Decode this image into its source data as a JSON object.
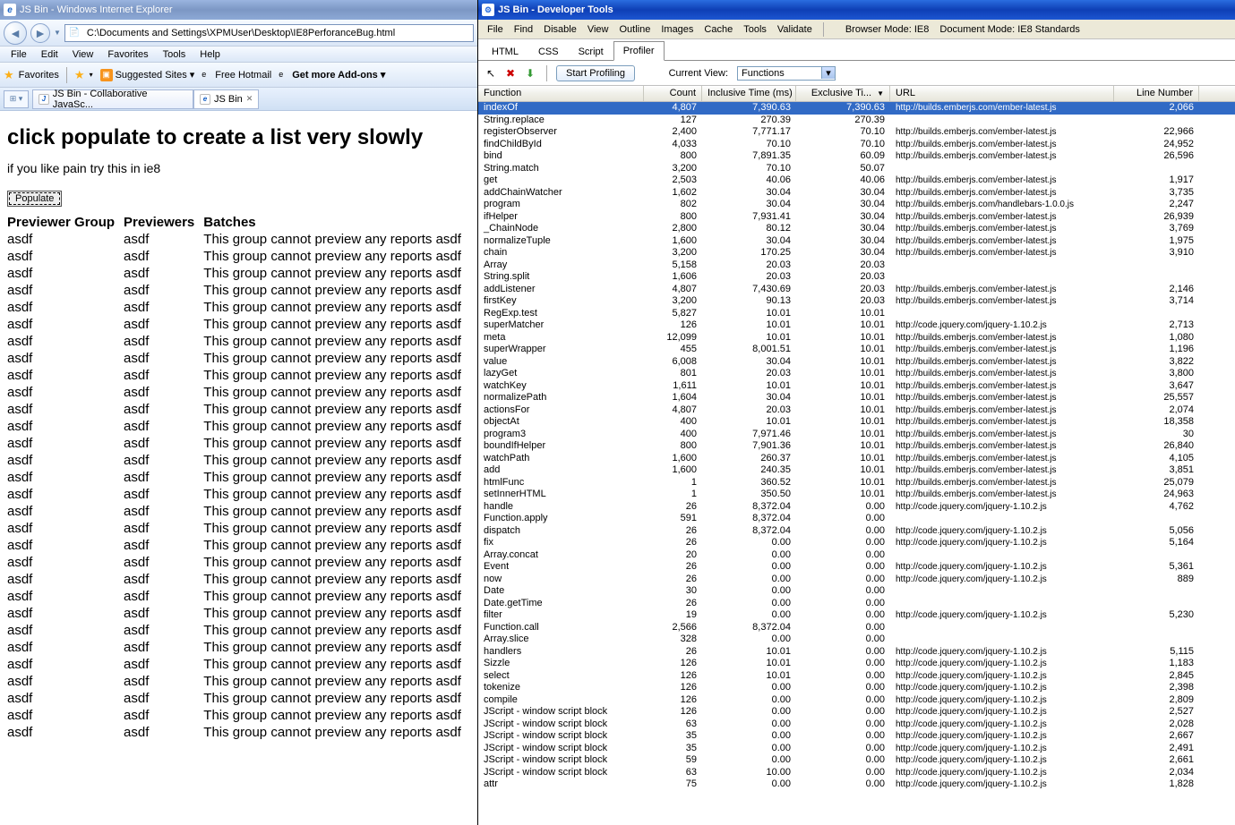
{
  "ie": {
    "title": "JS Bin - Windows Internet Explorer",
    "url": "C:\\Documents and Settings\\XPMUser\\Desktop\\IE8PerforanceBug.html",
    "menu": [
      "File",
      "Edit",
      "View",
      "Favorites",
      "Tools",
      "Help"
    ],
    "favorites_label": "Favorites",
    "fav_items": [
      "Suggested Sites ▾",
      "Free Hotmail",
      "Get more Add-ons ▾"
    ],
    "tabs": [
      {
        "label": "JS Bin - Collaborative JavaSc...",
        "active": false
      },
      {
        "label": "JS Bin",
        "active": true
      }
    ],
    "page": {
      "heading": "click populate to create a list very slowly",
      "sub": "if you like pain try this in ie8",
      "button": "Populate",
      "headers": [
        "Previewer Group",
        "Previewers",
        "Batches"
      ],
      "row": [
        "asdf",
        "asdf",
        "This group cannot preview any reports asdf"
      ],
      "row_count": 30
    }
  },
  "dev": {
    "title": "JS Bin - Developer Tools",
    "menu": [
      "File",
      "Find",
      "Disable",
      "View",
      "Outline",
      "Images",
      "Cache",
      "Tools",
      "Validate"
    ],
    "browser_mode_label": "Browser Mode: IE8",
    "doc_mode_label": "Document Mode: IE8 Standards",
    "tabs": [
      "HTML",
      "CSS",
      "Script",
      "Profiler"
    ],
    "active_tab": "Profiler",
    "start_button": "Start Profiling",
    "current_view_label": "Current View:",
    "current_view_value": "Functions",
    "columns": [
      "Function",
      "Count",
      "Inclusive Time (ms)",
      "Exclusive Ti...",
      "URL",
      "Line Number"
    ],
    "url_ember": "http://builds.emberjs.com/ember-latest.js",
    "url_jquery": "http://code.jquery.com/jquery-1.10.2.js",
    "url_hb": "http://builds.emberjs.com/handlebars-1.0.0.js",
    "rows": [
      {
        "fn": "indexOf",
        "ct": "4,807",
        "it": "7,390.63",
        "et": "7,390.63",
        "url": "ember",
        "ln": "2,066"
      },
      {
        "fn": "String.replace",
        "ct": "127",
        "it": "270.39",
        "et": "270.39",
        "url": "",
        "ln": ""
      },
      {
        "fn": "registerObserver",
        "ct": "2,400",
        "it": "7,771.17",
        "et": "70.10",
        "url": "ember",
        "ln": "22,966"
      },
      {
        "fn": "findChildById",
        "ct": "4,033",
        "it": "70.10",
        "et": "70.10",
        "url": "ember",
        "ln": "24,952"
      },
      {
        "fn": "bind",
        "ct": "800",
        "it": "7,891.35",
        "et": "60.09",
        "url": "ember",
        "ln": "26,596"
      },
      {
        "fn": "String.match",
        "ct": "3,200",
        "it": "70.10",
        "et": "50.07",
        "url": "",
        "ln": ""
      },
      {
        "fn": "get",
        "ct": "2,503",
        "it": "40.06",
        "et": "40.06",
        "url": "ember",
        "ln": "1,917"
      },
      {
        "fn": "addChainWatcher",
        "ct": "1,602",
        "it": "30.04",
        "et": "30.04",
        "url": "ember",
        "ln": "3,735"
      },
      {
        "fn": "program",
        "ct": "802",
        "it": "30.04",
        "et": "30.04",
        "url": "hb",
        "ln": "2,247"
      },
      {
        "fn": "ifHelper",
        "ct": "800",
        "it": "7,931.41",
        "et": "30.04",
        "url": "ember",
        "ln": "26,939"
      },
      {
        "fn": "_ChainNode",
        "ct": "2,800",
        "it": "80.12",
        "et": "30.04",
        "url": "ember",
        "ln": "3,769"
      },
      {
        "fn": "normalizeTuple",
        "ct": "1,600",
        "it": "30.04",
        "et": "30.04",
        "url": "ember",
        "ln": "1,975"
      },
      {
        "fn": "chain",
        "ct": "3,200",
        "it": "170.25",
        "et": "30.04",
        "url": "ember",
        "ln": "3,910"
      },
      {
        "fn": "Array",
        "ct": "5,158",
        "it": "20.03",
        "et": "20.03",
        "url": "",
        "ln": ""
      },
      {
        "fn": "String.split",
        "ct": "1,606",
        "it": "20.03",
        "et": "20.03",
        "url": "",
        "ln": ""
      },
      {
        "fn": "addListener",
        "ct": "4,807",
        "it": "7,430.69",
        "et": "20.03",
        "url": "ember",
        "ln": "2,146"
      },
      {
        "fn": "firstKey",
        "ct": "3,200",
        "it": "90.13",
        "et": "20.03",
        "url": "ember",
        "ln": "3,714"
      },
      {
        "fn": "RegExp.test",
        "ct": "5,827",
        "it": "10.01",
        "et": "10.01",
        "url": "",
        "ln": ""
      },
      {
        "fn": "superMatcher",
        "ct": "126",
        "it": "10.01",
        "et": "10.01",
        "url": "jquery",
        "ln": "2,713"
      },
      {
        "fn": "meta",
        "ct": "12,099",
        "it": "10.01",
        "et": "10.01",
        "url": "ember",
        "ln": "1,080"
      },
      {
        "fn": "superWrapper",
        "ct": "455",
        "it": "8,001.51",
        "et": "10.01",
        "url": "ember",
        "ln": "1,196"
      },
      {
        "fn": "value",
        "ct": "6,008",
        "it": "30.04",
        "et": "10.01",
        "url": "ember",
        "ln": "3,822"
      },
      {
        "fn": "lazyGet",
        "ct": "801",
        "it": "20.03",
        "et": "10.01",
        "url": "ember",
        "ln": "3,800"
      },
      {
        "fn": "watchKey",
        "ct": "1,611",
        "it": "10.01",
        "et": "10.01",
        "url": "ember",
        "ln": "3,647"
      },
      {
        "fn": "normalizePath",
        "ct": "1,604",
        "it": "30.04",
        "et": "10.01",
        "url": "ember",
        "ln": "25,557"
      },
      {
        "fn": "actionsFor",
        "ct": "4,807",
        "it": "20.03",
        "et": "10.01",
        "url": "ember",
        "ln": "2,074"
      },
      {
        "fn": "objectAt",
        "ct": "400",
        "it": "10.01",
        "et": "10.01",
        "url": "ember",
        "ln": "18,358"
      },
      {
        "fn": "program3",
        "ct": "400",
        "it": "7,971.46",
        "et": "10.01",
        "url": "ember",
        "ln": "30"
      },
      {
        "fn": "boundIfHelper",
        "ct": "800",
        "it": "7,901.36",
        "et": "10.01",
        "url": "ember",
        "ln": "26,840"
      },
      {
        "fn": "watchPath",
        "ct": "1,600",
        "it": "260.37",
        "et": "10.01",
        "url": "ember",
        "ln": "4,105"
      },
      {
        "fn": "add",
        "ct": "1,600",
        "it": "240.35",
        "et": "10.01",
        "url": "ember",
        "ln": "3,851"
      },
      {
        "fn": "htmlFunc",
        "ct": "1",
        "it": "360.52",
        "et": "10.01",
        "url": "ember",
        "ln": "25,079"
      },
      {
        "fn": "setInnerHTML",
        "ct": "1",
        "it": "350.50",
        "et": "10.01",
        "url": "ember",
        "ln": "24,963"
      },
      {
        "fn": "handle",
        "ct": "26",
        "it": "8,372.04",
        "et": "0.00",
        "url": "jquery",
        "ln": "4,762"
      },
      {
        "fn": "Function.apply",
        "ct": "591",
        "it": "8,372.04",
        "et": "0.00",
        "url": "",
        "ln": ""
      },
      {
        "fn": "dispatch",
        "ct": "26",
        "it": "8,372.04",
        "et": "0.00",
        "url": "jquery",
        "ln": "5,056"
      },
      {
        "fn": "fix",
        "ct": "26",
        "it": "0.00",
        "et": "0.00",
        "url": "jquery",
        "ln": "5,164"
      },
      {
        "fn": "Array.concat",
        "ct": "20",
        "it": "0.00",
        "et": "0.00",
        "url": "",
        "ln": ""
      },
      {
        "fn": "Event",
        "ct": "26",
        "it": "0.00",
        "et": "0.00",
        "url": "jquery",
        "ln": "5,361"
      },
      {
        "fn": "now",
        "ct": "26",
        "it": "0.00",
        "et": "0.00",
        "url": "jquery",
        "ln": "889"
      },
      {
        "fn": "Date",
        "ct": "30",
        "it": "0.00",
        "et": "0.00",
        "url": "",
        "ln": ""
      },
      {
        "fn": "Date.getTime",
        "ct": "26",
        "it": "0.00",
        "et": "0.00",
        "url": "",
        "ln": ""
      },
      {
        "fn": "filter",
        "ct": "19",
        "it": "0.00",
        "et": "0.00",
        "url": "jquery",
        "ln": "5,230"
      },
      {
        "fn": "Function.call",
        "ct": "2,566",
        "it": "8,372.04",
        "et": "0.00",
        "url": "",
        "ln": ""
      },
      {
        "fn": "Array.slice",
        "ct": "328",
        "it": "0.00",
        "et": "0.00",
        "url": "",
        "ln": ""
      },
      {
        "fn": "handlers",
        "ct": "26",
        "it": "10.01",
        "et": "0.00",
        "url": "jquery",
        "ln": "5,115"
      },
      {
        "fn": "Sizzle",
        "ct": "126",
        "it": "10.01",
        "et": "0.00",
        "url": "jquery",
        "ln": "1,183"
      },
      {
        "fn": "select",
        "ct": "126",
        "it": "10.01",
        "et": "0.00",
        "url": "jquery",
        "ln": "2,845"
      },
      {
        "fn": "tokenize",
        "ct": "126",
        "it": "0.00",
        "et": "0.00",
        "url": "jquery",
        "ln": "2,398"
      },
      {
        "fn": "compile",
        "ct": "126",
        "it": "0.00",
        "et": "0.00",
        "url": "jquery",
        "ln": "2,809"
      },
      {
        "fn": "JScript - window script block",
        "ct": "126",
        "it": "0.00",
        "et": "0.00",
        "url": "jquery",
        "ln": "2,527"
      },
      {
        "fn": "JScript - window script block",
        "ct": "63",
        "it": "0.00",
        "et": "0.00",
        "url": "jquery",
        "ln": "2,028"
      },
      {
        "fn": "JScript - window script block",
        "ct": "35",
        "it": "0.00",
        "et": "0.00",
        "url": "jquery",
        "ln": "2,667"
      },
      {
        "fn": "JScript - window script block",
        "ct": "35",
        "it": "0.00",
        "et": "0.00",
        "url": "jquery",
        "ln": "2,491"
      },
      {
        "fn": "JScript - window script block",
        "ct": "59",
        "it": "0.00",
        "et": "0.00",
        "url": "jquery",
        "ln": "2,661"
      },
      {
        "fn": "JScript - window script block",
        "ct": "63",
        "it": "10.00",
        "et": "0.00",
        "url": "jquery",
        "ln": "2,034"
      },
      {
        "fn": "attr",
        "ct": "75",
        "it": "0.00",
        "et": "0.00",
        "url": "jquery",
        "ln": "1,828"
      }
    ]
  }
}
